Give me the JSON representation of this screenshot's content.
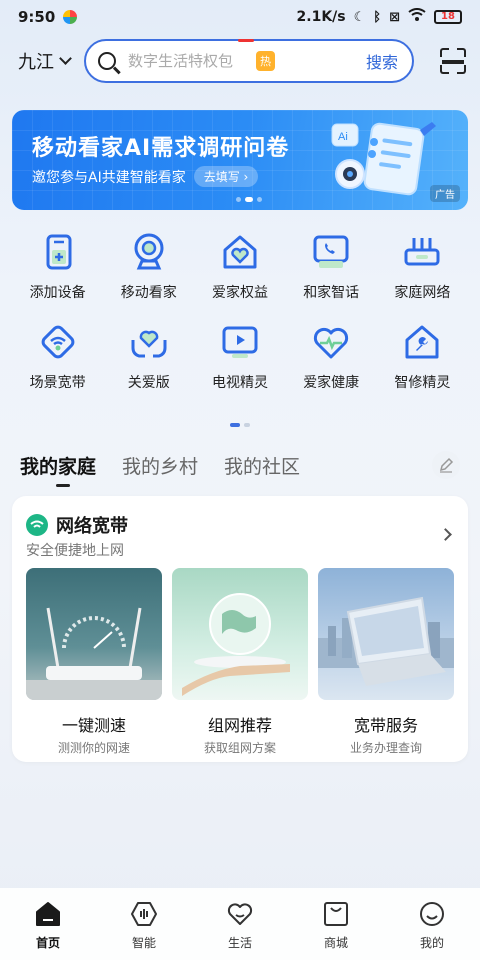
{
  "status_bar": {
    "time": "9:50",
    "speed": "2.1K/s",
    "battery": "18"
  },
  "header": {
    "city": "九江",
    "search_placeholder": "数字生活特权包",
    "hot_badge": "热",
    "search_button": "搜索"
  },
  "banner": {
    "title": "移动看家AI需求调研问卷",
    "subtitle": "邀您参与AI共建智能看家",
    "cta": "去填写",
    "ad_tag": "广告"
  },
  "quick_grid": [
    {
      "label": "添加设备",
      "icon": "add-device-icon"
    },
    {
      "label": "移动看家",
      "icon": "camera-icon"
    },
    {
      "label": "爱家权益",
      "icon": "home-heart-icon"
    },
    {
      "label": "和家智话",
      "icon": "phone-screen-icon"
    },
    {
      "label": "家庭网络",
      "icon": "router-icon"
    },
    {
      "label": "场景宽带",
      "icon": "wifi-diamond-icon"
    },
    {
      "label": "关爱版",
      "icon": "care-hands-icon"
    },
    {
      "label": "电视精灵",
      "icon": "tv-play-icon"
    },
    {
      "label": "爱家健康",
      "icon": "health-heart-icon"
    },
    {
      "label": "智修精灵",
      "icon": "repair-home-icon"
    }
  ],
  "tabs": [
    "我的家庭",
    "我的乡村",
    "我的社区"
  ],
  "card": {
    "title": "网络宽带",
    "subtitle": "安全便捷地上网",
    "tiles": [
      {
        "title": "一键测速",
        "desc": "测测你的网速"
      },
      {
        "title": "组网推荐",
        "desc": "获取组网方案"
      },
      {
        "title": "宽带服务",
        "desc": "业务办理查询"
      }
    ]
  },
  "bottom_nav": [
    {
      "label": "首页",
      "icon": "home-icon",
      "active": true
    },
    {
      "label": "智能",
      "icon": "smart-icon",
      "active": false
    },
    {
      "label": "生活",
      "icon": "life-heart-icon",
      "active": false
    },
    {
      "label": "商城",
      "icon": "mall-bag-icon",
      "active": false
    },
    {
      "label": "我的",
      "icon": "profile-smile-icon",
      "active": false
    }
  ],
  "colors": {
    "accent": "#3d6fe0",
    "banner": "#1f78f0",
    "broadband_green": "#1db686"
  }
}
